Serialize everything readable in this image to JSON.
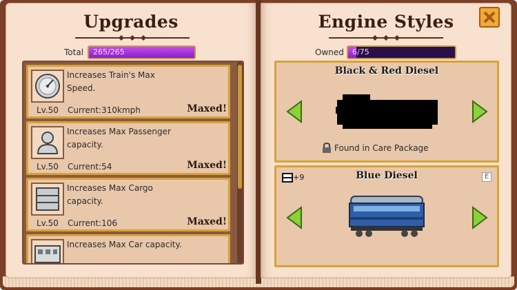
{
  "left_page": {
    "title": "Upgrades",
    "total_label": "Total",
    "total_value": "265/265",
    "total_fraction": 1.0,
    "upgrades": [
      {
        "icon": "speedometer-icon",
        "description": "Increases Train's Max Speed.",
        "level": "Lv.50",
        "current": "Current:310kmph",
        "status": "Maxed!"
      },
      {
        "icon": "passenger-icon",
        "description": "Increases Max Passenger capacity.",
        "level": "Lv.50",
        "current": "Current:54",
        "status": "Maxed!"
      },
      {
        "icon": "cargo-crate-icon",
        "description": "Increases Max Cargo capacity.",
        "level": "Lv.50",
        "current": "Current:106",
        "status": "Maxed!"
      },
      {
        "icon": "train-car-icon",
        "description": "Increases Max Car capacity.",
        "level": "",
        "current": "",
        "status": ""
      }
    ]
  },
  "right_page": {
    "title": "Engine Styles",
    "owned_label": "Owned",
    "owned_value": "6/75",
    "owned_fraction": 0.08,
    "styles": [
      {
        "name": "Black & Red Diesel",
        "note": "Found in Care Package",
        "locked": true
      },
      {
        "name": "Blue Diesel",
        "cars_badge": "+9",
        "key_hint": "E",
        "locked": false
      }
    ]
  },
  "colors": {
    "leather": "#7a3f26",
    "page": "#f8e2cf",
    "card": "#e8c7ab",
    "gold_border": "#d7a238",
    "progress_fill": "#c44cf0",
    "arrow_green": "#8bd13a"
  }
}
